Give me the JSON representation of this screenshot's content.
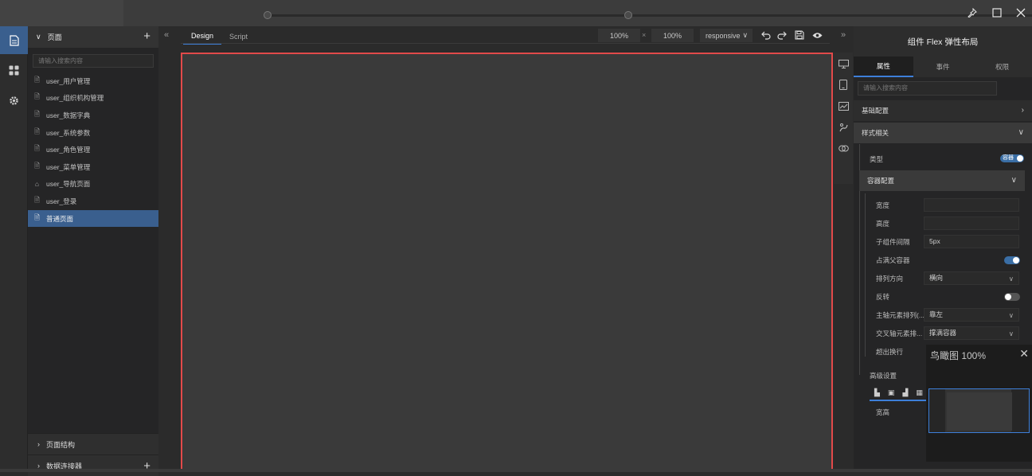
{
  "titlebar": {
    "pin_icon": "pin-icon",
    "maximize_icon": "maximize-icon",
    "close_icon": "close-icon"
  },
  "activity": {
    "items": [
      "pages-icon",
      "components-icon",
      "settings-icon"
    ]
  },
  "left_panel": {
    "header_label": "页面",
    "search_placeholder": "请输入搜索内容",
    "pages": [
      {
        "label": "user_用户管理",
        "icon": "file-icon"
      },
      {
        "label": "user_组织机构管理",
        "icon": "file-icon"
      },
      {
        "label": "user_数据字典",
        "icon": "file-icon"
      },
      {
        "label": "user_系统参数",
        "icon": "file-icon"
      },
      {
        "label": "user_角色管理",
        "icon": "file-icon"
      },
      {
        "label": "user_菜单管理",
        "icon": "file-icon"
      },
      {
        "label": "user_导航页面",
        "icon": "home-icon"
      },
      {
        "label": "user_登录",
        "icon": "file-icon"
      },
      {
        "label": "普通页面",
        "icon": "file-icon",
        "selected": true
      }
    ],
    "section_structure": "页面结构",
    "section_connectors": "数据连接器"
  },
  "toolbar": {
    "tab_design": "Design",
    "tab_script": "Script",
    "width_value": "100%",
    "separator": "×",
    "height_value": "100%",
    "mode_value": "responsive"
  },
  "right_panel": {
    "title": "组件 Flex 弹性布局",
    "tabs": [
      "属性",
      "事件",
      "权限"
    ],
    "search_placeholder": "请输入搜索内容",
    "section_basic": "基础配置",
    "section_style": "样式相关",
    "type_label": "类型",
    "type_badge": "容器",
    "container_section": "容器配置",
    "props": {
      "width_label": "宽度",
      "width_value": "",
      "height_label": "高度",
      "height_value": "",
      "gap_label": "子组件间隔",
      "gap_value": "5px",
      "fill_label": "占满父容器",
      "direction_label": "排列方向",
      "direction_value": "横向",
      "reverse_label": "反转",
      "main_axis_label": "主轴元素排列(...",
      "main_axis_value": "靠左",
      "cross_axis_label": "交叉轴元素排...",
      "cross_axis_value": "撑满容器",
      "wrap_label": "超出换行"
    },
    "advanced_label": "高级设置",
    "size_label": "宽高"
  },
  "minimap": {
    "title": "鸟瞰图 100%"
  },
  "colors": {
    "accent": "#3a5f8e",
    "canvas_border": "#e24a4a",
    "tab_underline": "#3d7fd9"
  }
}
